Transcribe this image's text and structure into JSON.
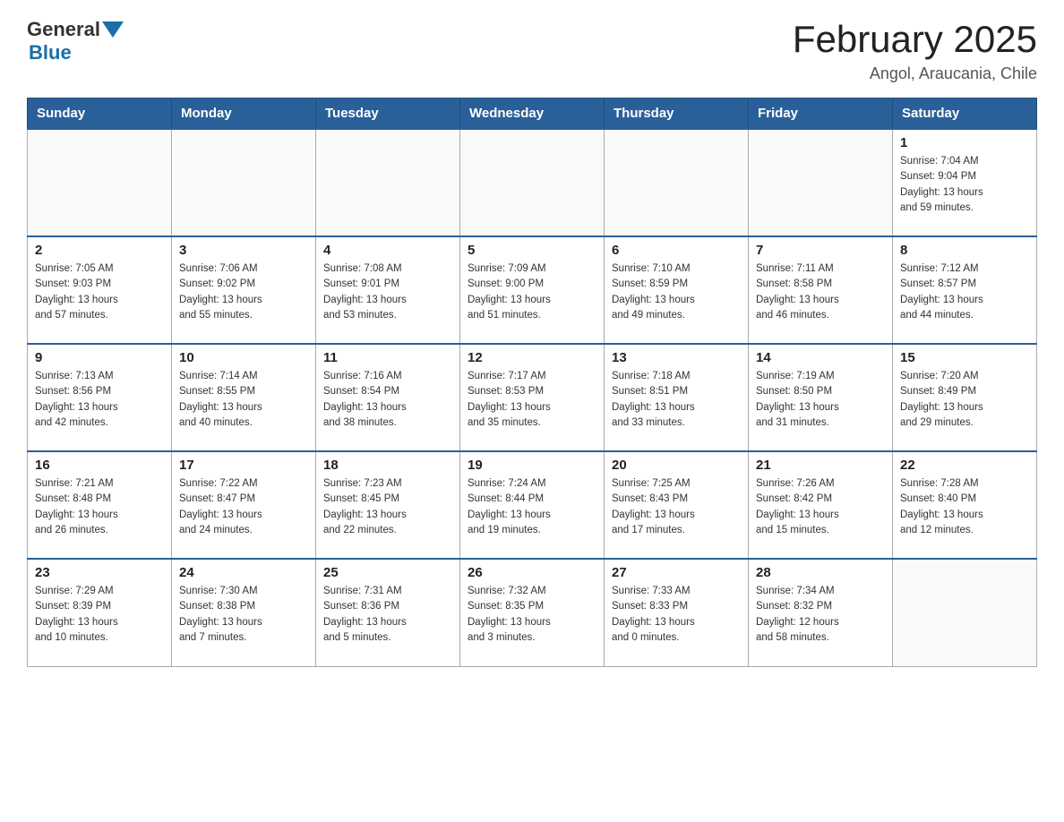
{
  "header": {
    "logo_general": "General",
    "logo_blue": "Blue",
    "month_title": "February 2025",
    "subtitle": "Angol, Araucania, Chile"
  },
  "weekdays": [
    "Sunday",
    "Monday",
    "Tuesday",
    "Wednesday",
    "Thursday",
    "Friday",
    "Saturday"
  ],
  "weeks": [
    [
      {
        "day": "",
        "info": ""
      },
      {
        "day": "",
        "info": ""
      },
      {
        "day": "",
        "info": ""
      },
      {
        "day": "",
        "info": ""
      },
      {
        "day": "",
        "info": ""
      },
      {
        "day": "",
        "info": ""
      },
      {
        "day": "1",
        "info": "Sunrise: 7:04 AM\nSunset: 9:04 PM\nDaylight: 13 hours\nand 59 minutes."
      }
    ],
    [
      {
        "day": "2",
        "info": "Sunrise: 7:05 AM\nSunset: 9:03 PM\nDaylight: 13 hours\nand 57 minutes."
      },
      {
        "day": "3",
        "info": "Sunrise: 7:06 AM\nSunset: 9:02 PM\nDaylight: 13 hours\nand 55 minutes."
      },
      {
        "day": "4",
        "info": "Sunrise: 7:08 AM\nSunset: 9:01 PM\nDaylight: 13 hours\nand 53 minutes."
      },
      {
        "day": "5",
        "info": "Sunrise: 7:09 AM\nSunset: 9:00 PM\nDaylight: 13 hours\nand 51 minutes."
      },
      {
        "day": "6",
        "info": "Sunrise: 7:10 AM\nSunset: 8:59 PM\nDaylight: 13 hours\nand 49 minutes."
      },
      {
        "day": "7",
        "info": "Sunrise: 7:11 AM\nSunset: 8:58 PM\nDaylight: 13 hours\nand 46 minutes."
      },
      {
        "day": "8",
        "info": "Sunrise: 7:12 AM\nSunset: 8:57 PM\nDaylight: 13 hours\nand 44 minutes."
      }
    ],
    [
      {
        "day": "9",
        "info": "Sunrise: 7:13 AM\nSunset: 8:56 PM\nDaylight: 13 hours\nand 42 minutes."
      },
      {
        "day": "10",
        "info": "Sunrise: 7:14 AM\nSunset: 8:55 PM\nDaylight: 13 hours\nand 40 minutes."
      },
      {
        "day": "11",
        "info": "Sunrise: 7:16 AM\nSunset: 8:54 PM\nDaylight: 13 hours\nand 38 minutes."
      },
      {
        "day": "12",
        "info": "Sunrise: 7:17 AM\nSunset: 8:53 PM\nDaylight: 13 hours\nand 35 minutes."
      },
      {
        "day": "13",
        "info": "Sunrise: 7:18 AM\nSunset: 8:51 PM\nDaylight: 13 hours\nand 33 minutes."
      },
      {
        "day": "14",
        "info": "Sunrise: 7:19 AM\nSunset: 8:50 PM\nDaylight: 13 hours\nand 31 minutes."
      },
      {
        "day": "15",
        "info": "Sunrise: 7:20 AM\nSunset: 8:49 PM\nDaylight: 13 hours\nand 29 minutes."
      }
    ],
    [
      {
        "day": "16",
        "info": "Sunrise: 7:21 AM\nSunset: 8:48 PM\nDaylight: 13 hours\nand 26 minutes."
      },
      {
        "day": "17",
        "info": "Sunrise: 7:22 AM\nSunset: 8:47 PM\nDaylight: 13 hours\nand 24 minutes."
      },
      {
        "day": "18",
        "info": "Sunrise: 7:23 AM\nSunset: 8:45 PM\nDaylight: 13 hours\nand 22 minutes."
      },
      {
        "day": "19",
        "info": "Sunrise: 7:24 AM\nSunset: 8:44 PM\nDaylight: 13 hours\nand 19 minutes."
      },
      {
        "day": "20",
        "info": "Sunrise: 7:25 AM\nSunset: 8:43 PM\nDaylight: 13 hours\nand 17 minutes."
      },
      {
        "day": "21",
        "info": "Sunrise: 7:26 AM\nSunset: 8:42 PM\nDaylight: 13 hours\nand 15 minutes."
      },
      {
        "day": "22",
        "info": "Sunrise: 7:28 AM\nSunset: 8:40 PM\nDaylight: 13 hours\nand 12 minutes."
      }
    ],
    [
      {
        "day": "23",
        "info": "Sunrise: 7:29 AM\nSunset: 8:39 PM\nDaylight: 13 hours\nand 10 minutes."
      },
      {
        "day": "24",
        "info": "Sunrise: 7:30 AM\nSunset: 8:38 PM\nDaylight: 13 hours\nand 7 minutes."
      },
      {
        "day": "25",
        "info": "Sunrise: 7:31 AM\nSunset: 8:36 PM\nDaylight: 13 hours\nand 5 minutes."
      },
      {
        "day": "26",
        "info": "Sunrise: 7:32 AM\nSunset: 8:35 PM\nDaylight: 13 hours\nand 3 minutes."
      },
      {
        "day": "27",
        "info": "Sunrise: 7:33 AM\nSunset: 8:33 PM\nDaylight: 13 hours\nand 0 minutes."
      },
      {
        "day": "28",
        "info": "Sunrise: 7:34 AM\nSunset: 8:32 PM\nDaylight: 12 hours\nand 58 minutes."
      },
      {
        "day": "",
        "info": ""
      }
    ]
  ]
}
